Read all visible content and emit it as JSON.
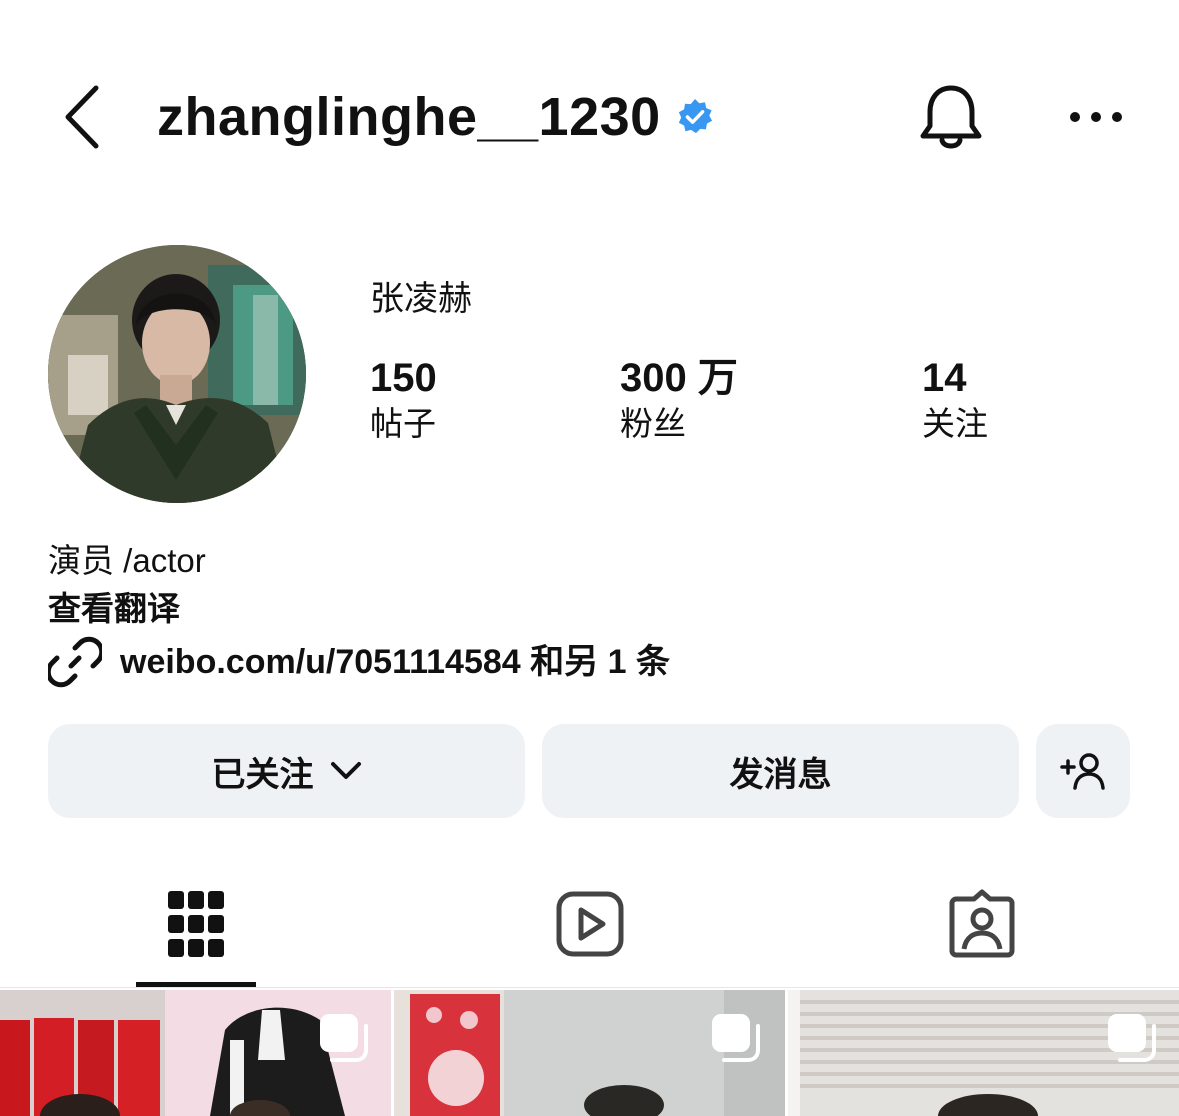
{
  "header": {
    "username": "zhanglinghe__1230",
    "back_icon": "chevron-left-icon",
    "verified_icon": "verified-badge-icon",
    "bell_icon": "bell-icon",
    "more_icon": "more-horizontal-icon",
    "verified_color": "#3897f0"
  },
  "profile": {
    "display_name": "张凌赫",
    "stats": [
      {
        "value": "150",
        "label": "帖子"
      },
      {
        "value": "300 万",
        "label": "粉丝"
      },
      {
        "value": "14",
        "label": "关注"
      }
    ],
    "bio": "演员 /actor",
    "translate_label": "查看翻译",
    "link_icon": "link-icon",
    "link_text": "weibo.com/u/7051114584 和另 1 条"
  },
  "actions": {
    "follow_label": "已关注",
    "follow_icon": "chevron-down-icon",
    "message_label": "发消息",
    "add_icon": "add-person-icon"
  },
  "tabs": [
    {
      "name": "posts",
      "icon": "grid-icon",
      "active": true
    },
    {
      "name": "reels",
      "icon": "reels-icon",
      "active": false
    },
    {
      "name": "tagged",
      "icon": "tagged-icon",
      "active": false
    }
  ],
  "grid": {
    "items": [
      {
        "icon": "multi-image-icon"
      },
      {
        "icon": "multi-image-icon"
      },
      {
        "icon": "multi-image-icon"
      }
    ]
  }
}
